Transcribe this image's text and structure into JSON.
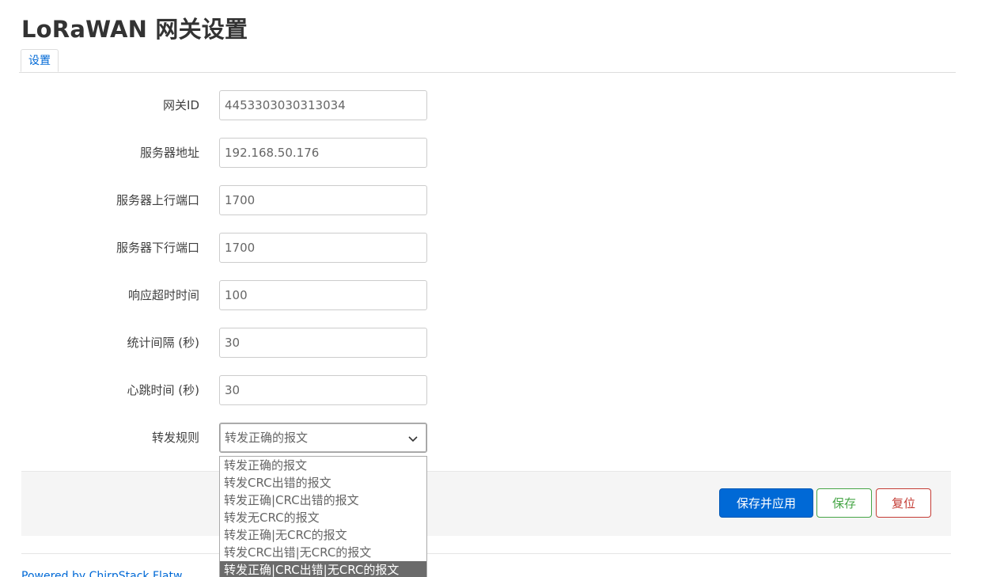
{
  "page": {
    "title": "LoRaWAN 网关设置"
  },
  "tabs": [
    {
      "label": "设置"
    }
  ],
  "form": {
    "gateway_id": {
      "label": "网关ID",
      "value": "4453303030313034"
    },
    "server_address": {
      "label": "服务器地址",
      "value": "192.168.50.176"
    },
    "server_up_port": {
      "label": "服务器上行端口",
      "value": "1700"
    },
    "server_down_port": {
      "label": "服务器下行端口",
      "value": "1700"
    },
    "response_timeout": {
      "label": "响应超时时间",
      "value": "100"
    },
    "stat_interval": {
      "label": "统计间隔 (秒)",
      "value": "30"
    },
    "keepalive_interval": {
      "label": "心跳时间 (秒)",
      "value": "30"
    },
    "forward_rule": {
      "label": "转发规则",
      "selected": "转发正确的报文",
      "options": [
        "转发正确的报文",
        "转发CRC出错的报文",
        "转发正确|CRC出错的报文",
        "转发无CRC的报文",
        "转发正确|无CRC的报文",
        "转发CRC出错|无CRC的报文",
        "转发正确|CRC出错|无CRC的报文"
      ],
      "highlighted_option": "转发正确|CRC出错|无CRC的报文"
    }
  },
  "actions": {
    "save_apply_label": "保存并应用",
    "save_label": "保存",
    "reset_label": "复位"
  },
  "footer": {
    "text": "Powered by ChirpStack Flatw"
  },
  "colors": {
    "accent": "#0069d6",
    "save_green": "#46a546",
    "reset_red": "#c43c35",
    "title_text": "#333333",
    "highlight_bg": "#6b6b6b"
  },
  "icons": {
    "select_chevron": "chevron-down-icon"
  }
}
